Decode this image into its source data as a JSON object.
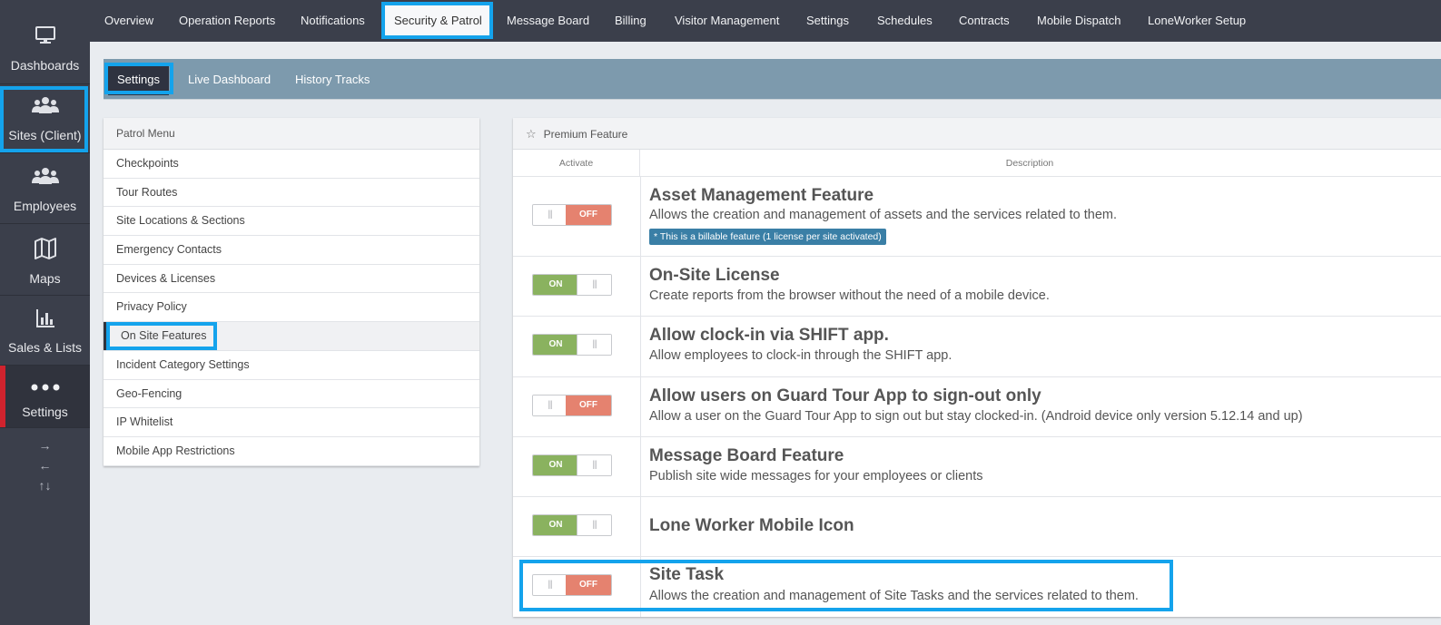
{
  "sidebar": {
    "items": [
      {
        "label": "Dashboards",
        "icon": "monitor-icon"
      },
      {
        "label": "Sites (Client)",
        "icon": "users-group-icon"
      },
      {
        "label": "Employees",
        "icon": "employees-icon"
      },
      {
        "label": "Maps",
        "icon": "map-icon"
      },
      {
        "label": "Sales & Lists",
        "icon": "bar-chart-icon"
      },
      {
        "label": "Settings",
        "icon": "more-dots-icon"
      }
    ],
    "arrows": [
      "→",
      "←",
      "↑↓"
    ]
  },
  "topnav": {
    "tabs": [
      "Overview",
      "Operation Reports",
      "Notifications",
      "Security & Patrol",
      "Message Board",
      "Billing",
      "Visitor Management",
      "Settings",
      "Schedules",
      "Contracts",
      "Mobile Dispatch",
      "LoneWorker Setup"
    ]
  },
  "subnav": {
    "tabs": [
      "Settings",
      "Live Dashboard",
      "History Tracks"
    ]
  },
  "patrol_menu": {
    "title": "Patrol Menu",
    "items": [
      "Checkpoints",
      "Tour Routes",
      "Site Locations & Sections",
      "Emergency Contacts",
      "Devices & Licenses",
      "Privacy Policy",
      "On Site Features",
      "Incident Category Settings",
      "Geo-Fencing",
      "IP Whitelist",
      "Mobile App Restrictions"
    ]
  },
  "features": {
    "title": "Premium Feature",
    "col_activate": "Activate",
    "col_description": "Description",
    "rows": [
      {
        "state": "OFF",
        "title": "Asset Management Feature",
        "desc": "Allows the creation and management of assets and the services related to them.",
        "badge": "* This is a billable feature (1 license per site activated)"
      },
      {
        "state": "ON",
        "title": "On-Site License",
        "desc": "Create reports from the browser without the need of a mobile device."
      },
      {
        "state": "ON",
        "title": "Allow clock-in via SHIFT app.",
        "desc": "Allow employees to clock-in through the SHIFT app."
      },
      {
        "state": "OFF",
        "title": "Allow users on Guard Tour App to sign-out only",
        "desc": "Allow a user on the Guard Tour App to sign out but stay clocked-in. (Android device only version 5.12.14 and up)"
      },
      {
        "state": "ON",
        "title": "Message Board Feature",
        "desc": "Publish site wide messages for your employees or clients"
      },
      {
        "state": "ON",
        "title": "Lone Worker Mobile Icon",
        "desc": ""
      },
      {
        "state": "OFF",
        "title": "Site Task",
        "desc": "Allows the creation and management of Site Tasks and the services related to them."
      }
    ],
    "knob_glyph": "|||"
  }
}
